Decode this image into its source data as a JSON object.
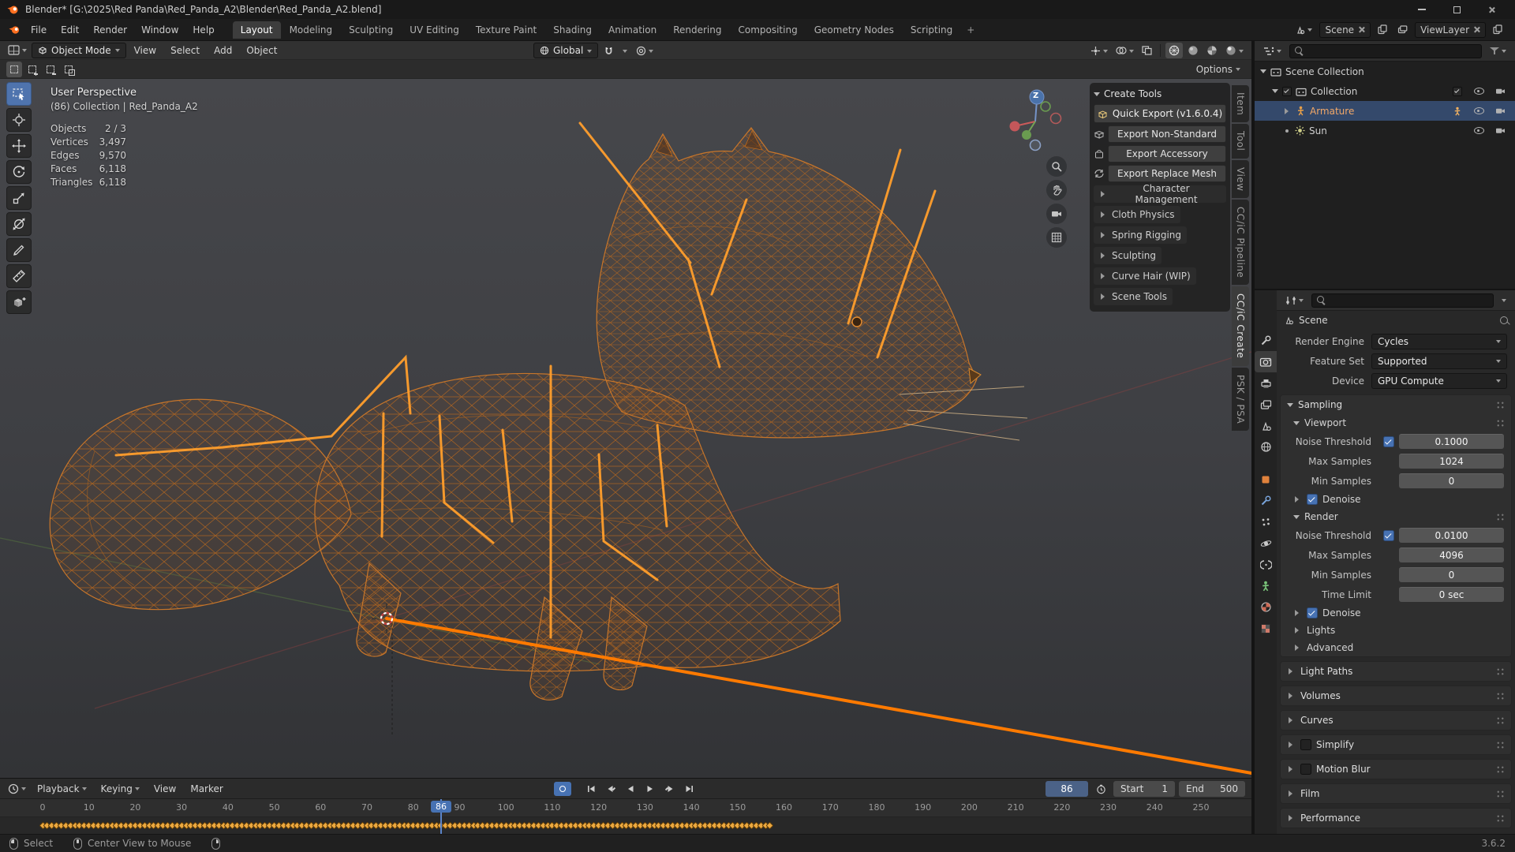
{
  "titlebar": {
    "title": "Blender* [G:\\2025\\Red Panda\\Red_Panda_A2\\Blender\\Red_Panda_A2.blend]"
  },
  "menubar": {
    "menus": [
      "File",
      "Edit",
      "Render",
      "Window",
      "Help"
    ],
    "workspaces": [
      "Layout",
      "Modeling",
      "Sculpting",
      "UV Editing",
      "Texture Paint",
      "Shading",
      "Animation",
      "Rendering",
      "Compositing",
      "Geometry Nodes",
      "Scripting"
    ],
    "active_workspace": "Layout",
    "add_workspace_label": "+",
    "scene_label": "Scene",
    "view_layer_label": "ViewLayer"
  },
  "viewport": {
    "header": {
      "mode": "Object Mode",
      "menus": [
        "View",
        "Select",
        "Add",
        "Object"
      ],
      "orientation": "Global",
      "options": "Options"
    },
    "overlay": {
      "perspective": "User Perspective",
      "collection": "(86) Collection | Red_Panda_A2",
      "stats": [
        {
          "label": "Objects",
          "value": "2 / 3"
        },
        {
          "label": "Vertices",
          "value": "3,497"
        },
        {
          "label": "Edges",
          "value": "9,570"
        },
        {
          "label": "Faces",
          "value": "6,118"
        },
        {
          "label": "Triangles",
          "value": "6,118"
        }
      ]
    },
    "gizmo": {
      "z_label": "Z"
    }
  },
  "create_tools": {
    "title": "Create Tools",
    "quick_export": "Quick Export  (v1.6.0.4)",
    "export_buttons": [
      "Export Non-Standard",
      "Export Accessory",
      "Export Replace Mesh"
    ],
    "sections": [
      "Character Management",
      "Cloth Physics",
      "Spring Rigging",
      "Sculpting",
      "Curve Hair (WIP)",
      "Scene Tools"
    ]
  },
  "sidebar_tabs": [
    "Item",
    "Tool",
    "View",
    "CC/iC Pipeline",
    "CC/iC Create",
    "PSK / PSA"
  ],
  "active_sidebar_tab": "CC/iC Create",
  "outliner": {
    "rows": [
      {
        "name": "Scene Collection"
      },
      {
        "name": "Collection"
      },
      {
        "name": "Armature"
      },
      {
        "name": "Sun"
      }
    ]
  },
  "properties": {
    "breadcrumb": "Scene",
    "render_engine": {
      "label": "Render Engine",
      "value": "Cycles"
    },
    "feature_set": {
      "label": "Feature Set",
      "value": "Supported"
    },
    "device": {
      "label": "Device",
      "value": "GPU Compute"
    },
    "sampling": {
      "title": "Sampling",
      "viewport": {
        "title": "Viewport",
        "noise_threshold": {
          "label": "Noise Threshold",
          "value": "0.1000"
        },
        "max_samples": {
          "label": "Max Samples",
          "value": "1024"
        },
        "min_samples": {
          "label": "Min Samples",
          "value": "0"
        },
        "denoise": "Denoise"
      },
      "render": {
        "title": "Render",
        "noise_threshold": {
          "label": "Noise Threshold",
          "value": "0.0100"
        },
        "max_samples": {
          "label": "Max Samples",
          "value": "4096"
        },
        "min_samples": {
          "label": "Min Samples",
          "value": "0"
        },
        "time_limit": {
          "label": "Time Limit",
          "value": "0 sec"
        },
        "denoise": "Denoise"
      },
      "lights": "Lights",
      "advanced": "Advanced"
    },
    "panels": [
      "Light Paths",
      "Volumes",
      "Curves",
      "Simplify",
      "Motion Blur",
      "Film",
      "Performance"
    ]
  },
  "timeline": {
    "menus": [
      "Playback",
      "Keying",
      "View",
      "Marker"
    ],
    "current_frame": "86",
    "start_label": "Start",
    "start_value": "1",
    "end_label": "End",
    "end_value": "500",
    "ruler": [
      "0",
      "10",
      "20",
      "30",
      "40",
      "50",
      "60",
      "70",
      "80",
      "90",
      "100",
      "110",
      "120",
      "130",
      "140",
      "150",
      "160",
      "170",
      "180",
      "190",
      "200",
      "210",
      "220",
      "230",
      "240",
      "250"
    ],
    "keyframe_first": 0,
    "keyframe_last": 157
  },
  "statusbar": {
    "items": [
      {
        "label": "Select"
      },
      {
        "label": "Center View to Mouse"
      }
    ],
    "version": "3.6.2"
  },
  "colors": {
    "accent": "#4772b3",
    "selection": "#ff7a00",
    "wireframe": "#c8762a"
  }
}
